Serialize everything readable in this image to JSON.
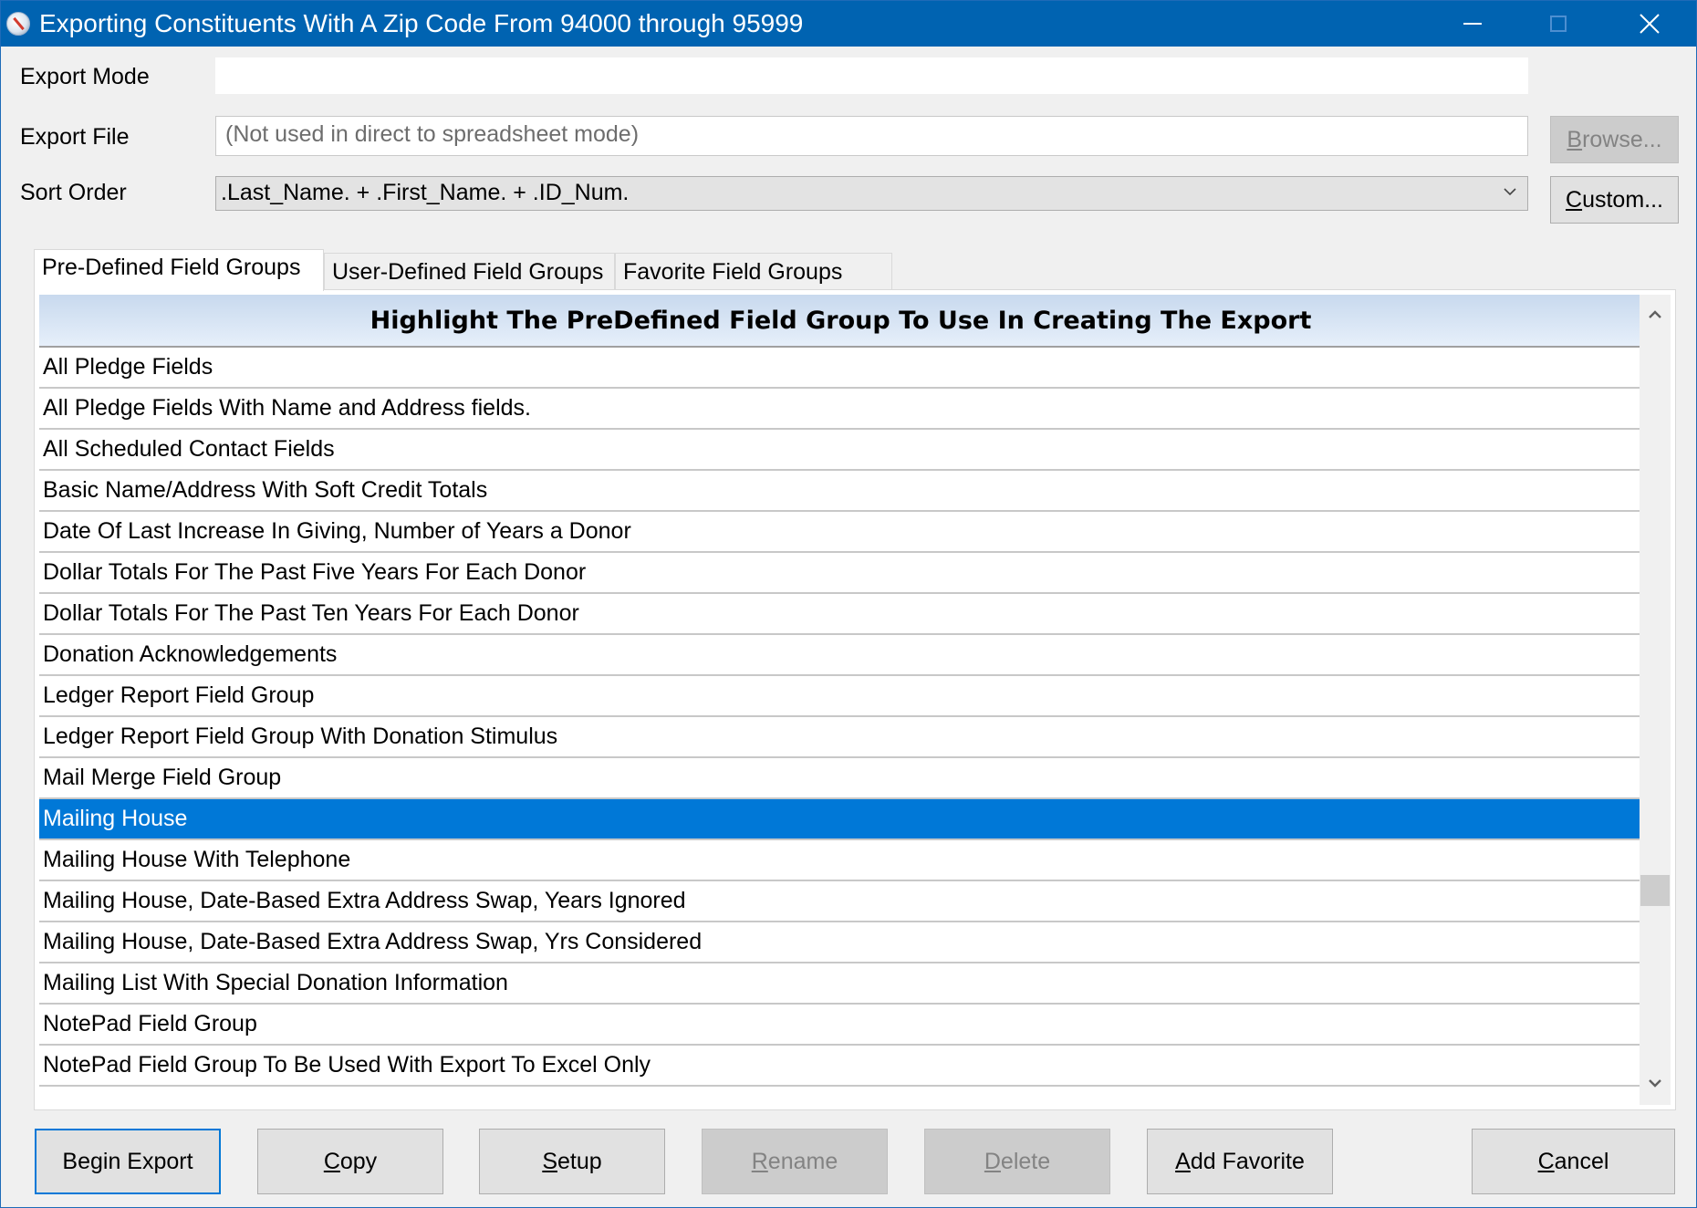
{
  "window": {
    "title": "Exporting Constituents With A Zip Code From 94000 through 95999",
    "controls": {
      "minimize": "minimize-icon",
      "maximize": "maximize-icon",
      "close": "close-icon"
    }
  },
  "form": {
    "export_mode": {
      "label": "Export Mode",
      "value": ""
    },
    "export_file": {
      "label": "Export File",
      "placeholder": "(Not used in direct to spreadsheet mode)",
      "value": ""
    },
    "sort_order": {
      "label": "Sort Order",
      "value": ".Last_Name. + .First_Name. + .ID_Num."
    },
    "browse_button": {
      "mn": "B",
      "rest": "rowse...",
      "enabled": false
    },
    "custom_button": {
      "mn": "C",
      "rest": "ustom...",
      "enabled": true
    }
  },
  "tabs": [
    {
      "label": "Pre-Defined Field Groups",
      "active": true
    },
    {
      "label": "User-Defined Field Groups",
      "active": false
    },
    {
      "label": "Favorite Field Groups",
      "active": false
    }
  ],
  "list": {
    "header": "Highlight The PreDefined Field Group To Use In Creating The Export",
    "selected_index": 11,
    "items": [
      "All Pledge Fields",
      "All Pledge Fields With Name and Address fields.",
      "All Scheduled Contact Fields",
      "Basic Name/Address With Soft Credit Totals",
      "Date Of Last Increase In Giving, Number of Years a Donor",
      "Dollar Totals For The Past Five Years For Each Donor",
      "Dollar Totals For The Past Ten Years For Each Donor",
      "Donation Acknowledgements",
      "Ledger Report Field Group",
      "Ledger Report Field Group With Donation Stimulus",
      "Mail Merge Field Group",
      "Mailing House",
      "Mailing House With Telephone",
      "Mailing House, Date-Based Extra Address Swap, Years Ignored",
      "Mailing House, Date-Based Extra Address Swap, Yrs Considered",
      "Mailing List With Special Donation Information",
      "NotePad Field Group",
      "NotePad Field Group To Be Used With Export To Excel Only"
    ]
  },
  "buttons": {
    "begin_export": {
      "mn": "",
      "rest": "Begin Export",
      "enabled": true
    },
    "copy": {
      "mn": "C",
      "rest": "opy",
      "enabled": true
    },
    "setup": {
      "mn": "S",
      "rest": "etup",
      "enabled": true
    },
    "rename": {
      "mn": "R",
      "rest": "ename",
      "enabled": false
    },
    "delete": {
      "mn": "D",
      "rest": "elete",
      "enabled": false
    },
    "add_favorite": {
      "mn": "A",
      "rest": "dd Favorite",
      "enabled": true
    },
    "cancel": {
      "mn": "C",
      "rest": "ancel",
      "enabled": true
    }
  },
  "colors": {
    "titlebar": "#0063b1",
    "selection": "#0078d7"
  }
}
